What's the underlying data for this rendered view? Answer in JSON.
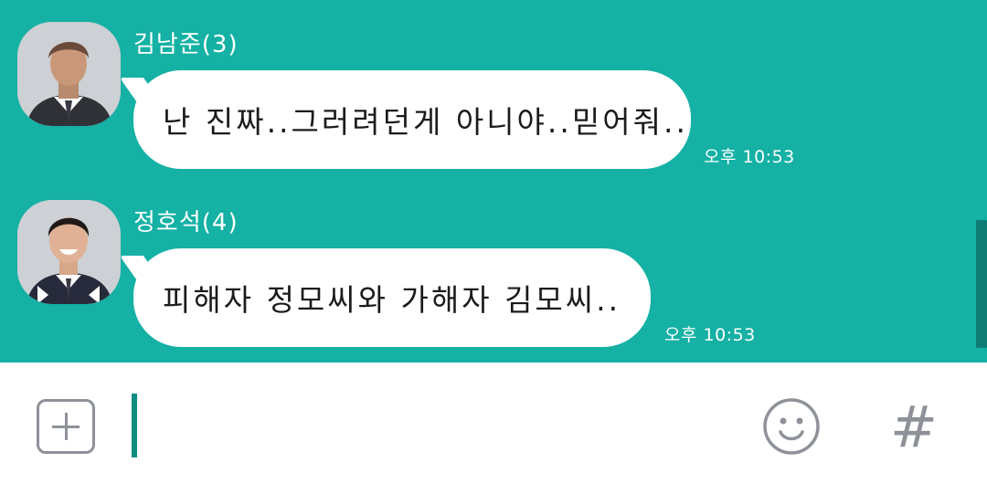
{
  "messages": [
    {
      "sender": "김남준(3)",
      "text": "난 진짜..그러려던게 아니야..믿어줘..",
      "time": "오후 10:53",
      "avatar_icon": "profile-photo"
    },
    {
      "sender": "정호석(4)",
      "text": "피해자 정모씨와 가해자 김모씨..",
      "time": "오후 10:53",
      "avatar_icon": "profile-photo"
    }
  ],
  "input_bar": {
    "placeholder": "",
    "value": "",
    "plus_icon": "plus-icon",
    "emoji_icon": "smiley-icon",
    "hash_symbol": "#"
  },
  "colors": {
    "chat_background": "#14B1A4",
    "bubble": "#FFFFFF",
    "cursor": "#0E8E82",
    "icon_gray": "#8E9298"
  }
}
